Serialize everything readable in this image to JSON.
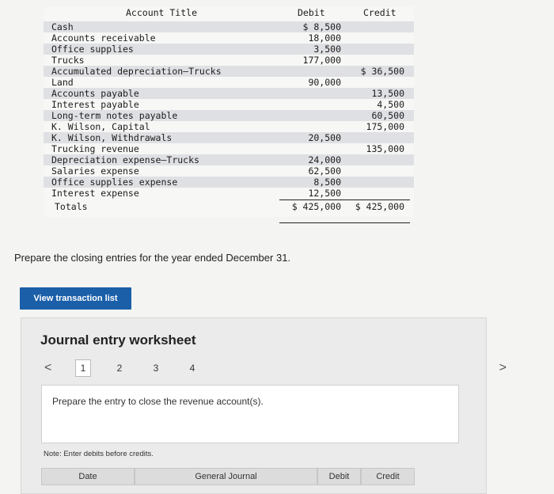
{
  "trial_balance": {
    "headers": {
      "account": "Account Title",
      "debit": "Debit",
      "credit": "Credit"
    },
    "rows": [
      {
        "account": "Cash",
        "debit": "$ 8,500",
        "credit": ""
      },
      {
        "account": "Accounts receivable",
        "debit": "18,000",
        "credit": ""
      },
      {
        "account": "Office supplies",
        "debit": "3,500",
        "credit": ""
      },
      {
        "account": "Trucks",
        "debit": "177,000",
        "credit": ""
      },
      {
        "account": "Accumulated depreciation–Trucks",
        "debit": "",
        "credit": "$ 36,500"
      },
      {
        "account": "Land",
        "debit": "90,000",
        "credit": ""
      },
      {
        "account": "Accounts payable",
        "debit": "",
        "credit": "13,500"
      },
      {
        "account": "Interest payable",
        "debit": "",
        "credit": "4,500"
      },
      {
        "account": "Long-term notes payable",
        "debit": "",
        "credit": "60,500"
      },
      {
        "account": "K. Wilson, Capital",
        "debit": "",
        "credit": "175,000"
      },
      {
        "account": "K. Wilson, Withdrawals",
        "debit": "20,500",
        "credit": ""
      },
      {
        "account": "Trucking revenue",
        "debit": "",
        "credit": "135,000"
      },
      {
        "account": "Depreciation expense–Trucks",
        "debit": "24,000",
        "credit": ""
      },
      {
        "account": "Salaries expense",
        "debit": "62,500",
        "credit": ""
      },
      {
        "account": "Office supplies expense",
        "debit": "8,500",
        "credit": ""
      },
      {
        "account": "Interest expense",
        "debit": "12,500",
        "credit": ""
      }
    ],
    "totals": {
      "label": "Totals",
      "debit": "$ 425,000",
      "credit": "$ 425,000"
    }
  },
  "prompt": "Prepare the closing entries for the year ended December 31.",
  "view_button": "View transaction list",
  "worksheet": {
    "title": "Journal entry worksheet",
    "nav_prev": "<",
    "nav_next": ">",
    "pages": [
      "1",
      "2",
      "3",
      "4"
    ],
    "active_page": "1",
    "instruction": "Prepare the entry to close the revenue account(s).",
    "note": "Note: Enter debits before credits.",
    "columns": {
      "date": "Date",
      "journal": "General Journal",
      "debit": "Debit",
      "credit": "Credit"
    }
  }
}
